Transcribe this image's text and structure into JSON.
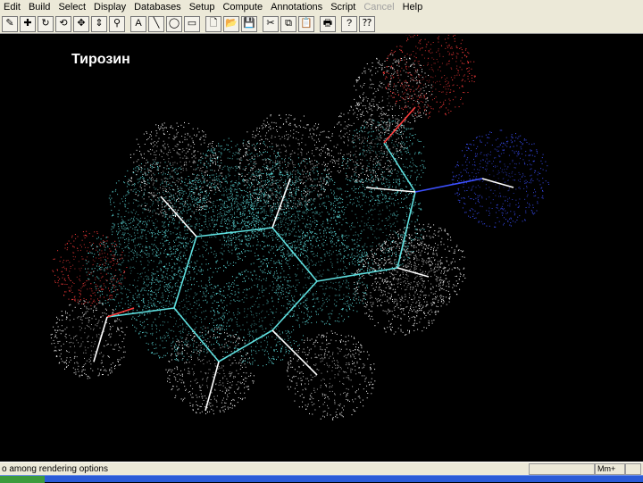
{
  "menubar": {
    "items": [
      {
        "label": "Edit",
        "disabled": false
      },
      {
        "label": "Build",
        "disabled": false
      },
      {
        "label": "Select",
        "disabled": false
      },
      {
        "label": "Display",
        "disabled": false
      },
      {
        "label": "Databases",
        "disabled": false
      },
      {
        "label": "Setup",
        "disabled": false
      },
      {
        "label": "Compute",
        "disabled": false
      },
      {
        "label": "Annotations",
        "disabled": false
      },
      {
        "label": "Script",
        "disabled": false
      },
      {
        "label": "Cancel",
        "disabled": true
      },
      {
        "label": "Help",
        "disabled": false
      }
    ]
  },
  "toolbar": {
    "buttons": [
      {
        "icon": "draw-tool-icon",
        "glyph": "✎"
      },
      {
        "icon": "select-tool-icon",
        "glyph": "✚"
      },
      {
        "icon": "rotate-tool-icon",
        "glyph": "↻"
      },
      {
        "icon": "z-rotate-tool-icon",
        "glyph": "⟲"
      },
      {
        "icon": "translate-tool-icon",
        "glyph": "✥"
      },
      {
        "icon": "z-translate-tool-icon",
        "glyph": "⇕"
      },
      {
        "icon": "zoom-tool-icon",
        "glyph": "⚲"
      },
      {
        "icon": "text-tool-icon",
        "glyph": "A"
      },
      {
        "icon": "line-tool-icon",
        "glyph": "╲"
      },
      {
        "icon": "ellipse-tool-icon",
        "glyph": "◯"
      },
      {
        "icon": "rectangle-tool-icon",
        "glyph": "▭"
      },
      {
        "icon": "new-file-icon",
        "glyph": "🗋"
      },
      {
        "icon": "open-file-icon",
        "glyph": "📂"
      },
      {
        "icon": "save-file-icon",
        "glyph": "💾"
      },
      {
        "icon": "cut-icon",
        "glyph": "✂"
      },
      {
        "icon": "copy-icon",
        "glyph": "⧉"
      },
      {
        "icon": "paste-icon",
        "glyph": "📋"
      },
      {
        "icon": "print-icon",
        "glyph": "🖶"
      },
      {
        "icon": "help-icon",
        "glyph": "?"
      },
      {
        "icon": "context-help-icon",
        "glyph": "⁇"
      }
    ]
  },
  "viewport": {
    "molecule_title": "Тирозин"
  },
  "statusbar": {
    "message": "o among rendering options",
    "mode": "Mm+"
  },
  "colors": {
    "carbon": "#5fe0e0",
    "oxygen": "#ff3c3c",
    "nitrogen": "#3c50ff",
    "hydrogen": "#ffffff",
    "background": "#000000"
  }
}
